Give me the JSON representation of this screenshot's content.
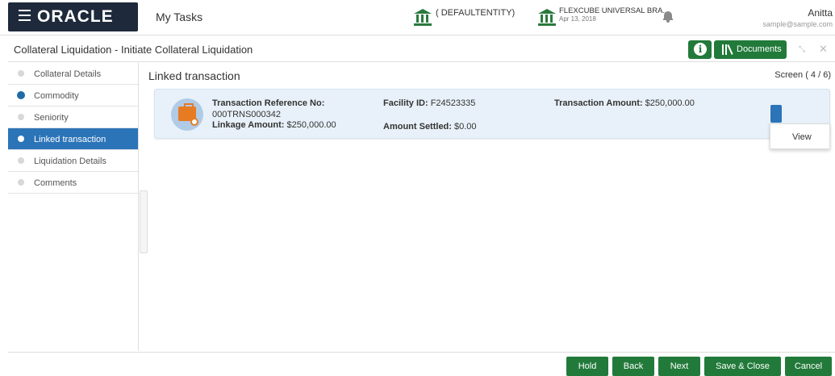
{
  "header": {
    "brand": "ORACLE",
    "my_tasks": "My Tasks",
    "entity": "( DEFAULTENTITY)",
    "branch_name": "FLEXCUBE UNIVERSAL BRA...",
    "branch_date": "Apr 13, 2018",
    "user_name": "Anitta",
    "user_email": "sample@sample.com",
    "icons": [
      "hamburger-menu-icon",
      "bank-icon",
      "bell-icon"
    ]
  },
  "titlebar": {
    "title": "Collateral Liquidation - Initiate Collateral Liquidation",
    "documents_label": "Documents",
    "info_glyph": "i",
    "minimize_glyph": "⤡",
    "close_glyph": "✕"
  },
  "sidebar": {
    "items": [
      {
        "label": "Collateral Details",
        "state": "pending"
      },
      {
        "label": "Commodity",
        "state": "done"
      },
      {
        "label": "Seniority",
        "state": "pending"
      },
      {
        "label": "Linked transaction",
        "state": "active"
      },
      {
        "label": "Liquidation Details",
        "state": "pending"
      },
      {
        "label": "Comments",
        "state": "pending"
      }
    ]
  },
  "main": {
    "section_title": "Linked transaction",
    "screen_indicator": "Screen ( 4 / 6)",
    "card": {
      "txn_ref_label": "Transaction Reference No:",
      "txn_ref_value": "000TRNS000342",
      "linkage_label": "Linkage Amount:",
      "linkage_value": "$250,000.00",
      "facility_label": "Facility ID:",
      "facility_value": "F24523335",
      "settled_label": "Amount Settled:",
      "settled_value": "$0.00",
      "txn_amount_label": "Transaction Amount:",
      "txn_amount_value": "$250,000.00"
    },
    "menu_view": "View"
  },
  "footer": {
    "hold": "Hold",
    "back": "Back",
    "next": "Next",
    "save_close": "Save & Close",
    "cancel": "Cancel"
  },
  "colors": {
    "brand_bg": "#1e2a3b",
    "accent_green": "#227a3a",
    "active_blue": "#2b74b8",
    "card_bg": "#e8f1f9"
  }
}
